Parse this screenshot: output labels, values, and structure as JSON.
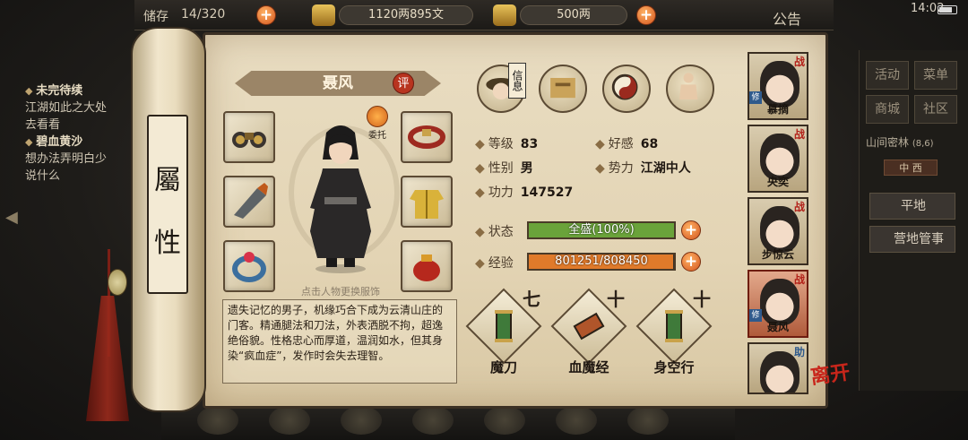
{
  "topbar": {
    "capacity": "14/320",
    "capacity_prefix": "储存",
    "money": "1120两895文",
    "silver": "500两",
    "notice": "公告",
    "time": "14:02"
  },
  "quests": [
    {
      "title": "未完待续",
      "desc": "江湖如此之大处去看看"
    },
    {
      "title": "碧血黄沙",
      "desc": "想办法弄明白少说什么"
    }
  ],
  "right_menu": {
    "buttons": [
      "活动",
      "菜单",
      "商城",
      "社区"
    ],
    "location": "山间密林",
    "location_coord": "(8,6)",
    "location_sub": "中 西",
    "actions": [
      "平地",
      "营地管事"
    ]
  },
  "scroll": {
    "label_top": "屬",
    "label_bottom": "性"
  },
  "character": {
    "name": "聂风",
    "rate_label": "评",
    "entrust_label": "委托",
    "change_hint": "点击人物更换服饰",
    "bio": "遗失记忆的男子，机缘巧合下成为云清山庄的门客。精通腿法和刀法，外表洒脱不拘，超逸绝俗貌。性格忠心而厚道，温润如水，但其身染“疯血症”，发作时会失去理智。"
  },
  "tabs": {
    "info_label": "信息"
  },
  "stats": {
    "level_label": "等级",
    "level": "83",
    "favor_label": "好感",
    "favor": "68",
    "gender_label": "性别",
    "gender": "男",
    "faction_label": "势力",
    "faction": "江湖中人",
    "power_label": "功力",
    "power": "147527",
    "status_label": "状态",
    "status_text": "全盛(100%)",
    "status_ratio": 1.0,
    "exp_label": "经验",
    "exp_text": "801251/808450",
    "exp_ratio": 0.991
  },
  "skills": [
    {
      "name": "魔刀",
      "plus": "七"
    },
    {
      "name": "血魔经",
      "plus": "十"
    },
    {
      "name": "身空行",
      "plus": "十"
    }
  ],
  "team": [
    {
      "name": "慕摘",
      "flag": "战",
      "tag": "修"
    },
    {
      "name": "央奕",
      "flag": "战",
      "tag": ""
    },
    {
      "name": "步惊云",
      "flag": "战",
      "tag": ""
    },
    {
      "name": "聂风",
      "flag": "战",
      "tag": "修"
    },
    {
      "name": "",
      "flag": "助",
      "tag": ""
    }
  ],
  "leave_label": "离开",
  "colors": {
    "status_bar": "#6aa33a",
    "exp_bar": "#e07a2a",
    "accent_red": "#b8341f"
  }
}
